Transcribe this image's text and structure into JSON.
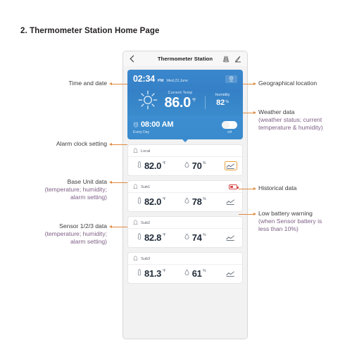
{
  "caption": "2. Thermometer Station Home Page",
  "phone": {
    "header": {
      "back_icon": "chevron-left-icon",
      "title": "Thermometer Station",
      "layers_icon": "layers-icon",
      "edit_icon": "pen-edit-icon"
    },
    "weather": {
      "time": "02:34",
      "meridiem": "PM",
      "date": "Wed,22,June",
      "location_icon": "location-pin-icon",
      "status_icon": "sun-icon",
      "temp_label": "Current Temp",
      "temp_value": "86.0",
      "temp_unit": "℉",
      "humidity_label": "Humidity",
      "humidity_value": "82",
      "humidity_unit": "%"
    },
    "alarm": {
      "clock_icon": "alarm-clock-icon",
      "time": "08:00 AM",
      "repeat": "Every Day",
      "toggle_state": "Off",
      "toggle_label": "Off"
    },
    "sensors": [
      {
        "name": "Local",
        "bell_icon": "bell-icon",
        "temp": "82.0",
        "temp_unit": "℉",
        "humidity": "70",
        "humidity_unit": "%",
        "chart_icon": "line-chart-icon",
        "chart_active": true,
        "low_battery": false
      },
      {
        "name": "Sub1",
        "bell_icon": "bell-icon",
        "temp": "82.0",
        "temp_unit": "℉",
        "humidity": "78",
        "humidity_unit": "%",
        "chart_icon": "line-chart-icon",
        "chart_active": false,
        "low_battery": true,
        "battery_icon": "low-battery-icon"
      },
      {
        "name": "Sub2",
        "bell_icon": "bell-icon",
        "temp": "82.8",
        "temp_unit": "℉",
        "humidity": "74",
        "humidity_unit": "%",
        "chart_icon": "line-chart-icon",
        "chart_active": false,
        "low_battery": false
      },
      {
        "name": "Sub3",
        "bell_icon": "bell-icon",
        "temp": "81.3",
        "temp_unit": "℉",
        "humidity": "61",
        "humidity_unit": "%",
        "chart_icon": "line-chart-icon",
        "chart_active": false,
        "low_battery": false
      }
    ]
  },
  "annotations": {
    "time_and_date": {
      "title": "Time and date",
      "sub": ""
    },
    "alarm_clock_setting": {
      "title": "Alarm clock setting",
      "sub": ""
    },
    "base_unit_data": {
      "title": "Base Unit data",
      "sub": "(temperature; humidity;\nalarm setting)"
    },
    "sensor_data": {
      "title": "Sensor 1/2/3 data",
      "sub": "(temperature; humidity;\nalarm setting)"
    },
    "geographical_location": {
      "title": "Geographical location",
      "sub": ""
    },
    "weather_data": {
      "title": "Weather data",
      "sub": "(weather status; current\ntemperature & humidity)"
    },
    "historical_data": {
      "title": "Historical data",
      "sub": ""
    },
    "low_battery_warning": {
      "title": "Low battery warning",
      "sub": "(when Sensor battery is\nless than 10%)"
    }
  },
  "colors": {
    "accent_blue": "#3a8bcd",
    "leader_orange": "#e0893f",
    "annotation_purple": "#7d5f84",
    "battery_red": "#d64b4b",
    "chart_highlight": "#e8a23b"
  }
}
